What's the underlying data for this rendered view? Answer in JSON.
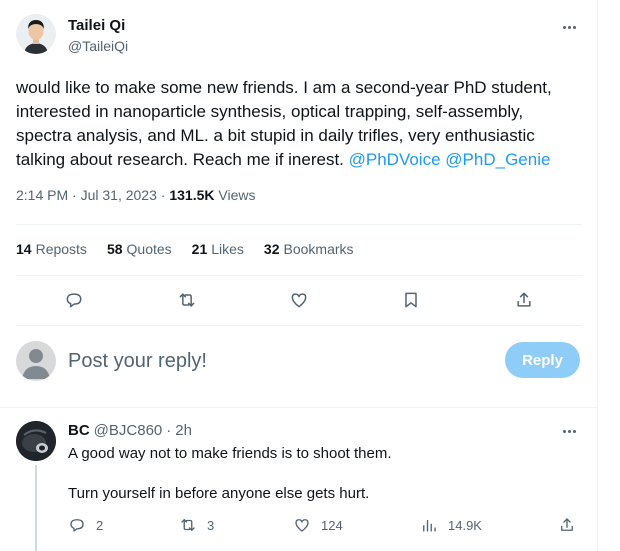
{
  "tweet": {
    "author": {
      "name": "Tailei Qi",
      "handle": "@TaileiQi"
    },
    "text_parts": {
      "body": "would like to make some new friends. I am a second-year PhD student, interested in nanoparticle synthesis, optical trapping, self-assembly, spectra analysis, and ML. a bit stupid in daily trifles, very enthusiastic talking about research. Reach me if inerest.",
      "mention1": "@PhDVoice",
      "mention2": "@PhD_Genie"
    },
    "meta": {
      "time": "2:14 PM",
      "sep": "·",
      "date": "Jul 31, 2023",
      "sep2": "·",
      "views_count": "131.5K",
      "views_label": "Views"
    },
    "stats": [
      {
        "count": "14",
        "label": "Reposts"
      },
      {
        "count": "58",
        "label": "Quotes"
      },
      {
        "count": "21",
        "label": "Likes"
      },
      {
        "count": "32",
        "label": "Bookmarks"
      }
    ],
    "actions": [
      "reply-icon",
      "repost-icon",
      "like-icon",
      "bookmark-icon",
      "share-icon"
    ]
  },
  "composer": {
    "placeholder": "Post your reply!",
    "button_label": "Reply",
    "button_color": "#8ecdf8"
  },
  "reply": {
    "name": "BC",
    "handle": "@BJC860",
    "sep": "·",
    "time": "2h",
    "line1": "A good way not to make friends is to shoot them.",
    "line2": "Turn yourself in before anyone else gets hurt.",
    "counts": {
      "replies": "2",
      "reposts": "3",
      "likes": "124",
      "views": "14.9K"
    }
  },
  "colors": {
    "accent": "#1d9bf0",
    "text": "#0f1419",
    "muted": "#536471",
    "divider": "#eff3f4"
  }
}
